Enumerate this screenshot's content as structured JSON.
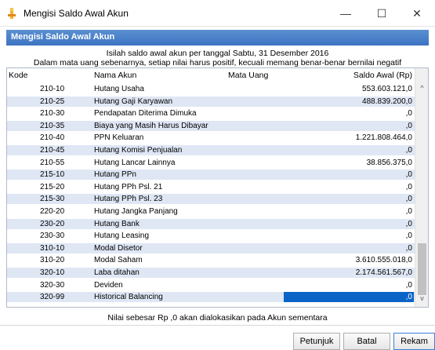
{
  "window": {
    "title": "Mengisi Saldo Awal Akun",
    "minimize": "—",
    "maximize": "☐",
    "close": "✕"
  },
  "panel": {
    "header": "Mengisi Saldo Awal Akun"
  },
  "instructions": {
    "line1": "Isilah saldo awal akun per tanggal Sabtu, 31 Desember 2016",
    "line2": "Dalam mata uang sebenarnya, setiap nilai harus positif, kecuali memang benar-benar bernilai negatif"
  },
  "table": {
    "headers": {
      "kode": "Kode",
      "nama": "Nama Akun",
      "mata_uang": "Mata Uang",
      "saldo": "Saldo Awal (Rp)"
    },
    "rows": [
      {
        "kode": "210-10",
        "nama": "Hutang Usaha",
        "saldo": "553.603.121,0"
      },
      {
        "kode": "210-25",
        "nama": "Hutang Gaji Karyawan",
        "saldo": "488.839.200,0"
      },
      {
        "kode": "210-30",
        "nama": "Pendapatan Diterima Dimuka",
        "saldo": ",0"
      },
      {
        "kode": "210-35",
        "nama": "Biaya yang Masih Harus Dibayar",
        "saldo": ",0"
      },
      {
        "kode": "210-40",
        "nama": "PPN Keluaran",
        "saldo": "1.221.808.464,0"
      },
      {
        "kode": "210-45",
        "nama": "Hutang Komisi Penjualan",
        "saldo": ",0"
      },
      {
        "kode": "210-55",
        "nama": "Hutang Lancar Lainnya",
        "saldo": "38.856.375,0"
      },
      {
        "kode": "215-10",
        "nama": "Hutang PPn",
        "saldo": ",0"
      },
      {
        "kode": "215-20",
        "nama": "Hutang PPh Psl. 21",
        "saldo": ",0"
      },
      {
        "kode": "215-30",
        "nama": "Hutang PPh Psl. 23",
        "saldo": ",0"
      },
      {
        "kode": "220-20",
        "nama": "Hutang Jangka Panjang",
        "saldo": ",0"
      },
      {
        "kode": "230-20",
        "nama": "Hutang Bank",
        "saldo": ",0"
      },
      {
        "kode": "230-30",
        "nama": "Hutang Leasing",
        "saldo": ",0"
      },
      {
        "kode": "310-10",
        "nama": "Modal Disetor",
        "saldo": ",0"
      },
      {
        "kode": "310-20",
        "nama": "Modal Saham",
        "saldo": "3.610.555.018,0"
      },
      {
        "kode": "320-10",
        "nama": "Laba ditahan",
        "saldo": "2.174.561.567,0"
      },
      {
        "kode": "320-30",
        "nama": "Deviden",
        "saldo": ",0"
      },
      {
        "kode": "320-99",
        "nama": "Historical Balancing",
        "saldo": ",0"
      }
    ],
    "selected_row": 17
  },
  "scrollbar": {
    "up": "^",
    "down": "v"
  },
  "footer_note": "Nilai sebesar Rp ,0 akan dialokasikan pada Akun sementara",
  "buttons": {
    "help": "Petunjuk",
    "cancel": "Batal",
    "save": "Rekam"
  },
  "colors": {
    "header_bar": "#3d74c2",
    "row_stripe": "#dfe7f5",
    "selection": "#0a64c8"
  }
}
